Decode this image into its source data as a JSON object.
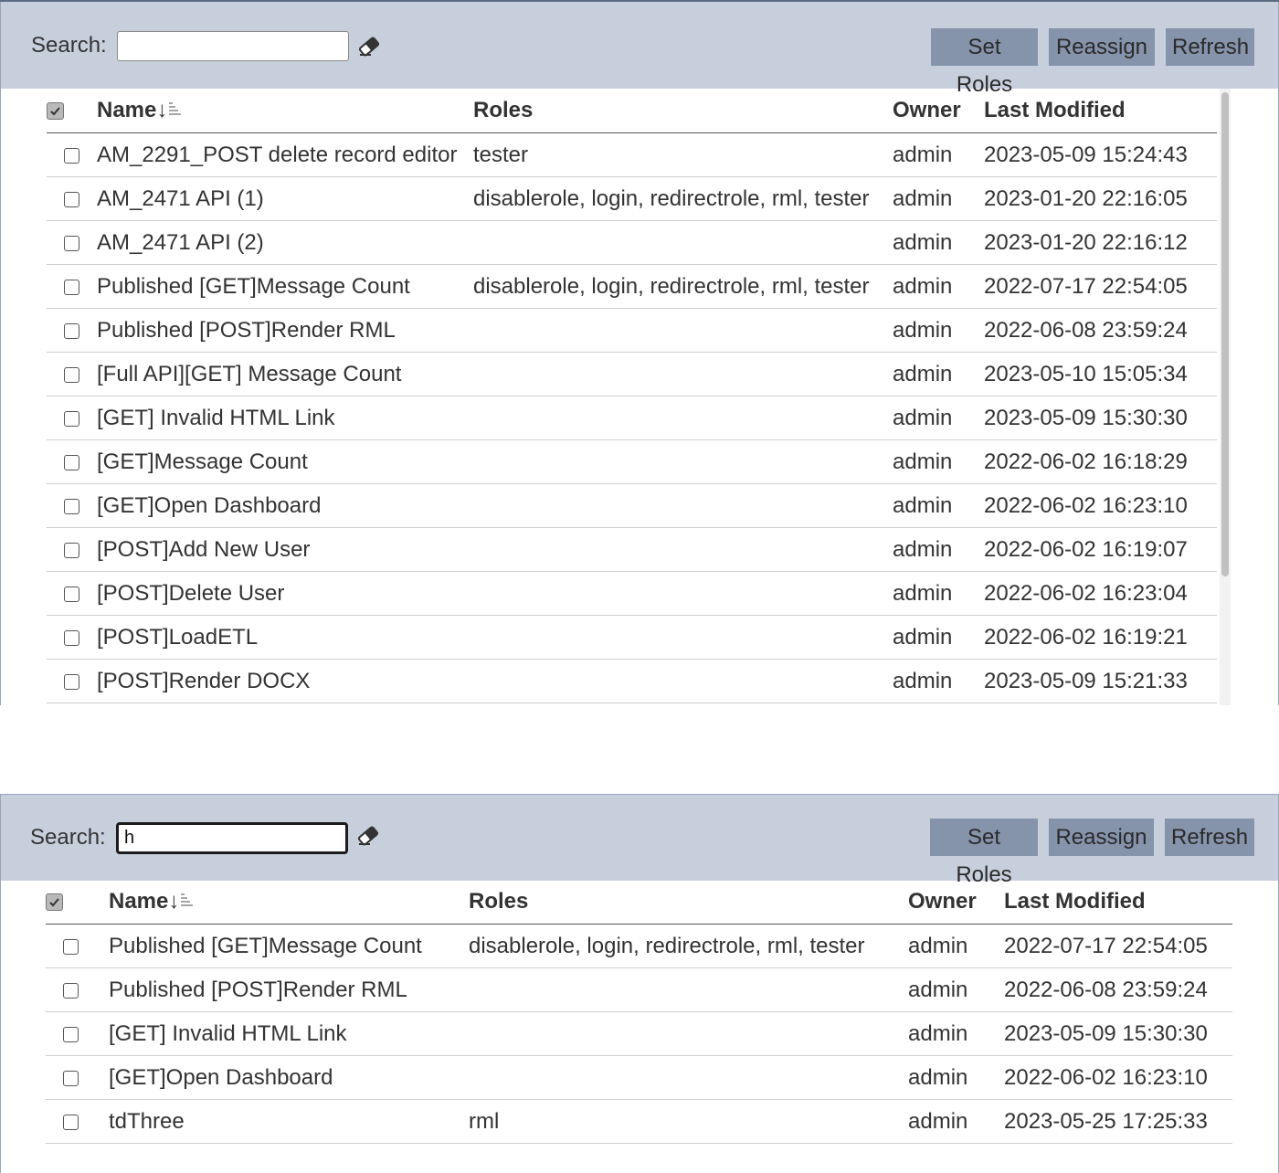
{
  "panels": [
    {
      "search": {
        "label": "Search:",
        "value": ""
      },
      "buttons": {
        "set_roles": "Set Roles",
        "reassign": "Reassign",
        "refresh": "Refresh"
      },
      "columns": {
        "name": "Name",
        "sort_arrow": "↓",
        "roles": "Roles",
        "owner": "Owner",
        "last_modified": "Last Modified"
      },
      "rows": [
        {
          "name": "AM_2291_POST delete record editor",
          "roles": "tester",
          "owner": "admin",
          "last_modified": "2023-05-09 15:24:43"
        },
        {
          "name": "AM_2471 API (1)",
          "roles": "disablerole, login, redirectrole, rml, tester",
          "owner": "admin",
          "last_modified": "2023-01-20 22:16:05"
        },
        {
          "name": "AM_2471 API (2)",
          "roles": "",
          "owner": "admin",
          "last_modified": "2023-01-20 22:16:12"
        },
        {
          "name": "Published [GET]Message Count",
          "roles": "disablerole, login, redirectrole, rml, tester",
          "owner": "admin",
          "last_modified": "2022-07-17 22:54:05"
        },
        {
          "name": "Published [POST]Render RML",
          "roles": "",
          "owner": "admin",
          "last_modified": "2022-06-08 23:59:24"
        },
        {
          "name": "[Full API][GET] Message Count",
          "roles": "",
          "owner": "admin",
          "last_modified": "2023-05-10 15:05:34"
        },
        {
          "name": "[GET] Invalid HTML Link",
          "roles": "",
          "owner": "admin",
          "last_modified": "2023-05-09 15:30:30"
        },
        {
          "name": "[GET]Message Count",
          "roles": "",
          "owner": "admin",
          "last_modified": "2022-06-02 16:18:29"
        },
        {
          "name": "[GET]Open Dashboard",
          "roles": "",
          "owner": "admin",
          "last_modified": "2022-06-02 16:23:10"
        },
        {
          "name": "[POST]Add New User",
          "roles": "",
          "owner": "admin",
          "last_modified": "2022-06-02 16:19:07"
        },
        {
          "name": "[POST]Delete User",
          "roles": "",
          "owner": "admin",
          "last_modified": "2022-06-02 16:23:04"
        },
        {
          "name": "[POST]LoadETL",
          "roles": "",
          "owner": "admin",
          "last_modified": "2022-06-02 16:19:21"
        },
        {
          "name": "[POST]Render DOCX",
          "roles": "",
          "owner": "admin",
          "last_modified": "2023-05-09 15:21:33"
        }
      ]
    },
    {
      "search": {
        "label": "Search:",
        "value": "h"
      },
      "buttons": {
        "set_roles": "Set Roles",
        "reassign": "Reassign",
        "refresh": "Refresh"
      },
      "columns": {
        "name": "Name",
        "sort_arrow": "↓",
        "roles": "Roles",
        "owner": "Owner",
        "last_modified": "Last Modified"
      },
      "rows": [
        {
          "name": "Published [GET]Message Count",
          "roles": "disablerole, login, redirectrole, rml, tester",
          "owner": "admin",
          "last_modified": "2022-07-17 22:54:05"
        },
        {
          "name": "Published [POST]Render RML",
          "roles": "",
          "owner": "admin",
          "last_modified": "2022-06-08 23:59:24"
        },
        {
          "name": "[GET] Invalid HTML Link",
          "roles": "",
          "owner": "admin",
          "last_modified": "2023-05-09 15:30:30"
        },
        {
          "name": "[GET]Open Dashboard",
          "roles": "",
          "owner": "admin",
          "last_modified": "2022-06-02 16:23:10"
        },
        {
          "name": "tdThree",
          "roles": "rml",
          "owner": "admin",
          "last_modified": "2023-05-25 17:25:33"
        }
      ]
    }
  ]
}
